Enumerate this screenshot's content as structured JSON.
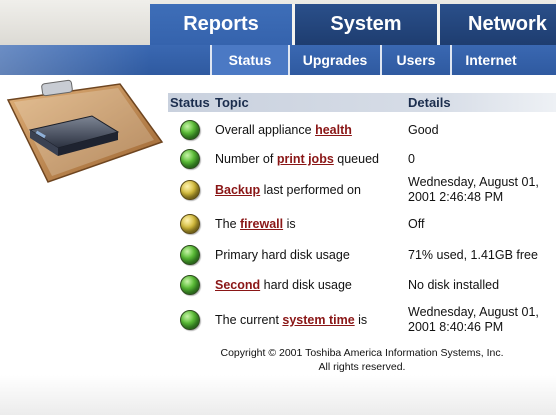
{
  "nav": {
    "main_tabs": [
      "Reports",
      "System",
      "Network"
    ],
    "sub_tabs": [
      "Status",
      "Upgrades",
      "Users",
      "Internet"
    ]
  },
  "table": {
    "headers": {
      "status": "Status",
      "topic": "Topic",
      "details": "Details"
    },
    "rows": [
      {
        "status": "green",
        "pre": "Overall appliance ",
        "link": "health",
        "post": "",
        "details": "Good"
      },
      {
        "status": "green",
        "pre": "Number of ",
        "link": "print jobs",
        "post": " queued",
        "details": "0"
      },
      {
        "status": "yellow",
        "pre": "",
        "link": "Backup",
        "post": " last performed on",
        "details": "Wednesday, August 01, 2001 2:46:48 PM"
      },
      {
        "status": "yellow",
        "pre": "The ",
        "link": "firewall",
        "post": " is",
        "details": "Off"
      },
      {
        "status": "green",
        "pre": "Primary hard disk usage",
        "link": "",
        "post": "",
        "details": "71% used, 1.41GB free"
      },
      {
        "status": "green",
        "pre": "",
        "link": "Second",
        "post": " hard disk usage",
        "details": "No disk installed"
      },
      {
        "status": "green",
        "pre": "The current ",
        "link": "system time",
        "post": " is",
        "details": "Wednesday, August 01, 2001 8:40:46 PM"
      }
    ]
  },
  "footer": {
    "line1": "Copyright © 2001 Toshiba America Information Systems, Inc.",
    "line2": "All rights reserved."
  },
  "icons": {
    "status_ok": "green-status-light-icon",
    "status_warn": "yellow-status-light-icon",
    "illustration": "clipboard-server-icon"
  },
  "colors": {
    "nav_dark": "#1e3d70",
    "nav_active": "#3563ad",
    "link": "#8a1616",
    "ok": "#5cbf38",
    "warn": "#d4bb3a"
  }
}
